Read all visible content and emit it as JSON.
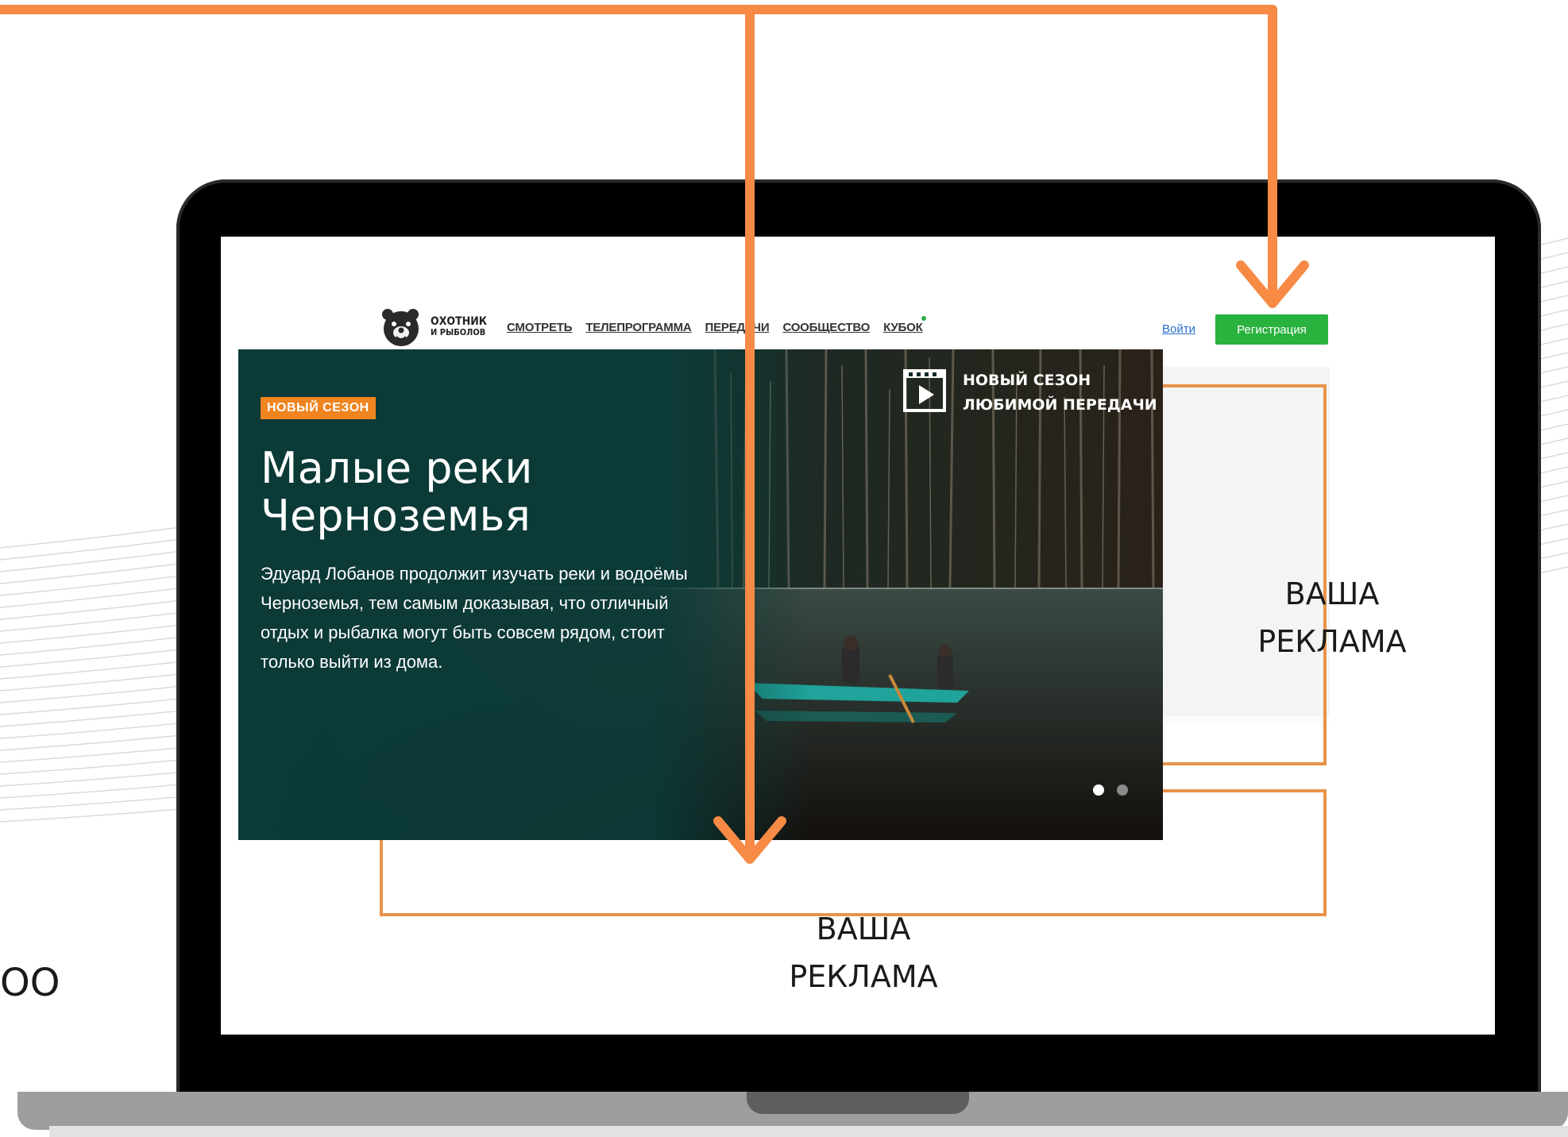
{
  "colors": {
    "arrow": "#f78a45",
    "ad_frame": "#e8934a",
    "register_bg": "#2ab23f",
    "badge_bg": "#f0841e",
    "hero_dark": "#0d3a37",
    "login_link": "#2a6fc9"
  },
  "background_text": "OO",
  "site": {
    "logo": {
      "icon": "bear-icon",
      "line1": "ОХОТНИК",
      "line2": "И РЫБОЛОВ"
    },
    "nav": [
      "СМОТРЕТЬ",
      "ТЕЛЕПРОГРАММА",
      "ПЕРЕДАЧИ",
      "СООБЩЕСТВО",
      "КУБОК"
    ],
    "login": "Войти",
    "register": "Регистрация"
  },
  "hero": {
    "badge": "НОВЫЙ СЕЗОН",
    "title": "Малые реки Черноземья",
    "description": "Эдуард Лобанов продолжит изучать реки и водоёмы Черноземья, тем самым доказывая, что отличный отдых и рыбалка могут быть совсем рядом, стоит только выйти из дома.",
    "season_icon": "play-icon",
    "season_line1": "НОВЫЙ СЕЗОН",
    "season_line2": "ЛЮБИМОЙ ПЕРЕДАЧИ",
    "slides_total": 2,
    "slide_active": 1
  },
  "ads": {
    "right_line1": "ВАША",
    "right_line2": "РЕКЛАМА",
    "bottom_line1": "ВАША",
    "bottom_line2": "РЕКЛАМА"
  }
}
